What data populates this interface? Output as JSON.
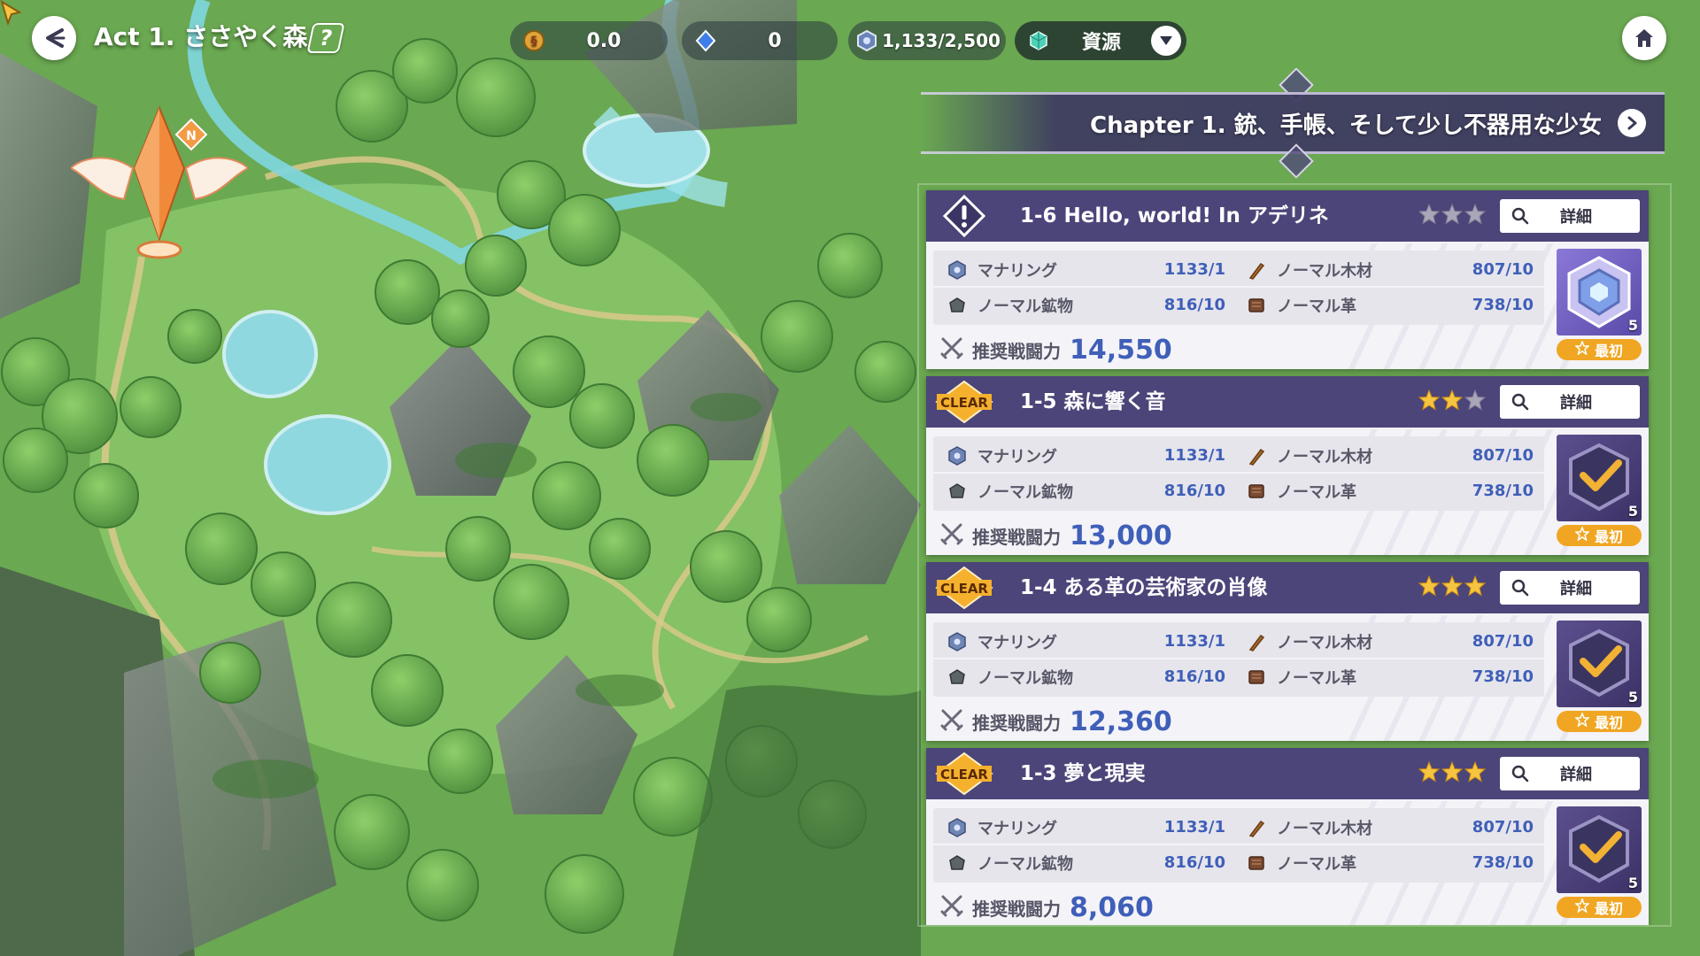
{
  "topbar": {
    "title": "Act 1. ささやく森",
    "help_symbol": "?",
    "resources": [
      {
        "icon": "gold-coin-icon",
        "value": "0.0"
      },
      {
        "icon": "blue-gem-icon",
        "value": "0"
      },
      {
        "icon": "mana-ring-icon",
        "value": "1,133/2,500"
      }
    ],
    "dropdown": {
      "icon": "crystal-cube-icon",
      "label": "資源"
    }
  },
  "chapter": {
    "title": "Chapter 1. 銃、手帳、そして少し不器用な少女"
  },
  "labels": {
    "detail": "詳細",
    "power": "推奨戦闘力",
    "first": "最初",
    "clear": "CLEAR",
    "mat1": "マナリング",
    "mat2": "ノーマル木材",
    "mat3": "ノーマル鉱物",
    "mat4": "ノーマル革"
  },
  "stages": [
    {
      "title": "1-6  Hello, world! In アデリネ",
      "status": "new",
      "stars": 0,
      "materials": [
        "1133/1",
        "807/10",
        "816/10",
        "738/10"
      ],
      "power": "14,550",
      "reward_count": "5"
    },
    {
      "title": "1-5  森に響く音",
      "status": "clear",
      "stars": 2,
      "materials": [
        "1133/1",
        "807/10",
        "816/10",
        "738/10"
      ],
      "power": "13,000",
      "reward_count": "5"
    },
    {
      "title": "1-4  ある革の芸術家の肖像",
      "status": "clear",
      "stars": 3,
      "materials": [
        "1133/1",
        "807/10",
        "816/10",
        "738/10"
      ],
      "power": "12,360",
      "reward_count": "5"
    },
    {
      "title": "1-3  夢と現実",
      "status": "clear",
      "stars": 3,
      "materials": [
        "1133/1",
        "807/10",
        "816/10",
        "738/10"
      ],
      "power": "8,060",
      "reward_count": "5"
    }
  ],
  "map": {
    "marker_letter": "N"
  },
  "colors": {
    "stage_header": "#4c4579",
    "accent_blue": "#3f5fb8",
    "star_gold": "#f5c542",
    "first_tag": "#f0a623"
  }
}
